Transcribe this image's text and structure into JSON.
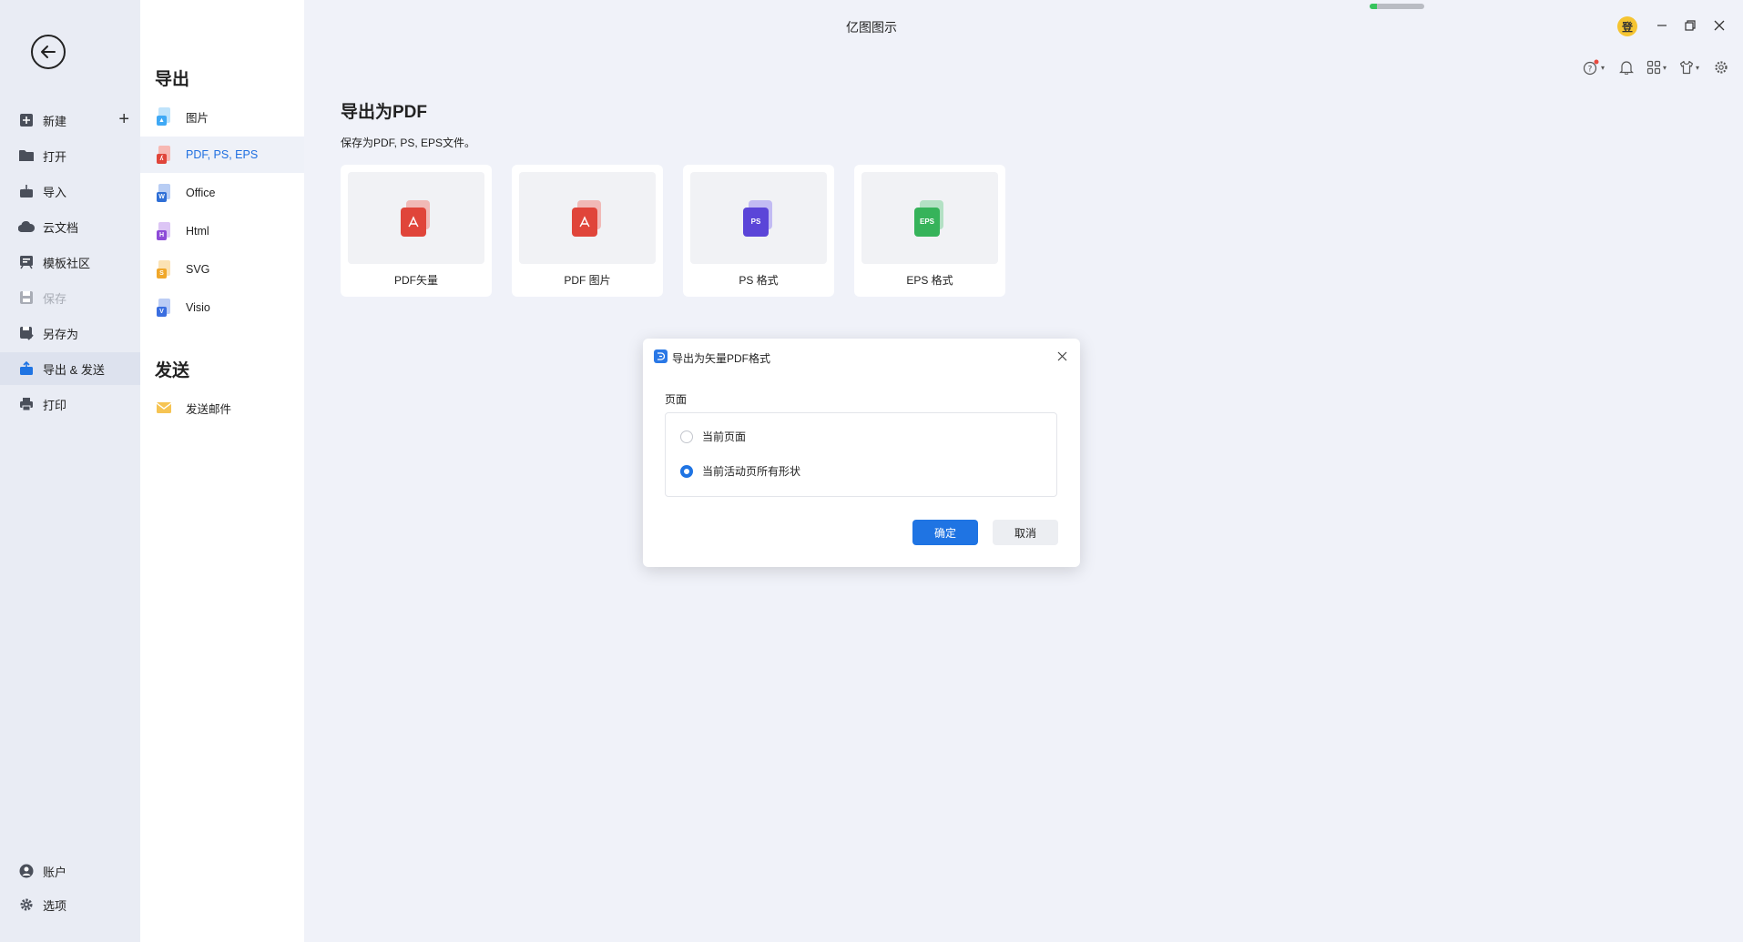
{
  "app": {
    "title": "亿图图示",
    "login_label": "登"
  },
  "leftnav": {
    "items": [
      {
        "label": "新建"
      },
      {
        "label": "打开"
      },
      {
        "label": "导入"
      },
      {
        "label": "云文档"
      },
      {
        "label": "模板社区"
      },
      {
        "label": "保存"
      },
      {
        "label": "另存为"
      },
      {
        "label": "导出 & 发送"
      },
      {
        "label": "打印"
      }
    ],
    "bottom": [
      {
        "label": "账户"
      },
      {
        "label": "选项"
      }
    ]
  },
  "submenu": {
    "export_heading": "导出",
    "export_items": [
      {
        "label": "图片",
        "badge": "",
        "color": "#3fa9f5"
      },
      {
        "label": "PDF, PS, EPS",
        "badge": "",
        "color": "#e0453a"
      },
      {
        "label": "Office",
        "badge": "W",
        "color": "#2f6fd6"
      },
      {
        "label": "Html",
        "badge": "H",
        "color": "#8e4bd8"
      },
      {
        "label": "SVG",
        "badge": "S",
        "color": "#f0a72a"
      },
      {
        "label": "Visio",
        "badge": "V",
        "color": "#3a6ee0"
      }
    ],
    "send_heading": "发送",
    "send_items": [
      {
        "label": "发送邮件"
      }
    ]
  },
  "content": {
    "title": "导出为PDF",
    "subtitle": "保存为PDF, PS, EPS文件。",
    "cards": [
      {
        "label": "PDF矢量",
        "badge": "",
        "color": "#e0453a"
      },
      {
        "label": "PDF 图片",
        "badge": "",
        "color": "#e0453a"
      },
      {
        "label": "PS 格式",
        "badge": "PS",
        "color": "#5b45d8"
      },
      {
        "label": "EPS 格式",
        "badge": "EPS",
        "color": "#36b35a"
      }
    ]
  },
  "dialog": {
    "title": "导出为矢量PDF格式",
    "section_label": "页面",
    "options": [
      {
        "label": "当前页面",
        "selected": false
      },
      {
        "label": "当前活动页所有形状",
        "selected": true
      }
    ],
    "ok_label": "确定",
    "cancel_label": "取消"
  },
  "status": {
    "progress": 0.14
  },
  "colors": {
    "accent": "#1f74e3",
    "nav_bg": "#e9ecf4",
    "page_bg": "#f0f2f9"
  }
}
